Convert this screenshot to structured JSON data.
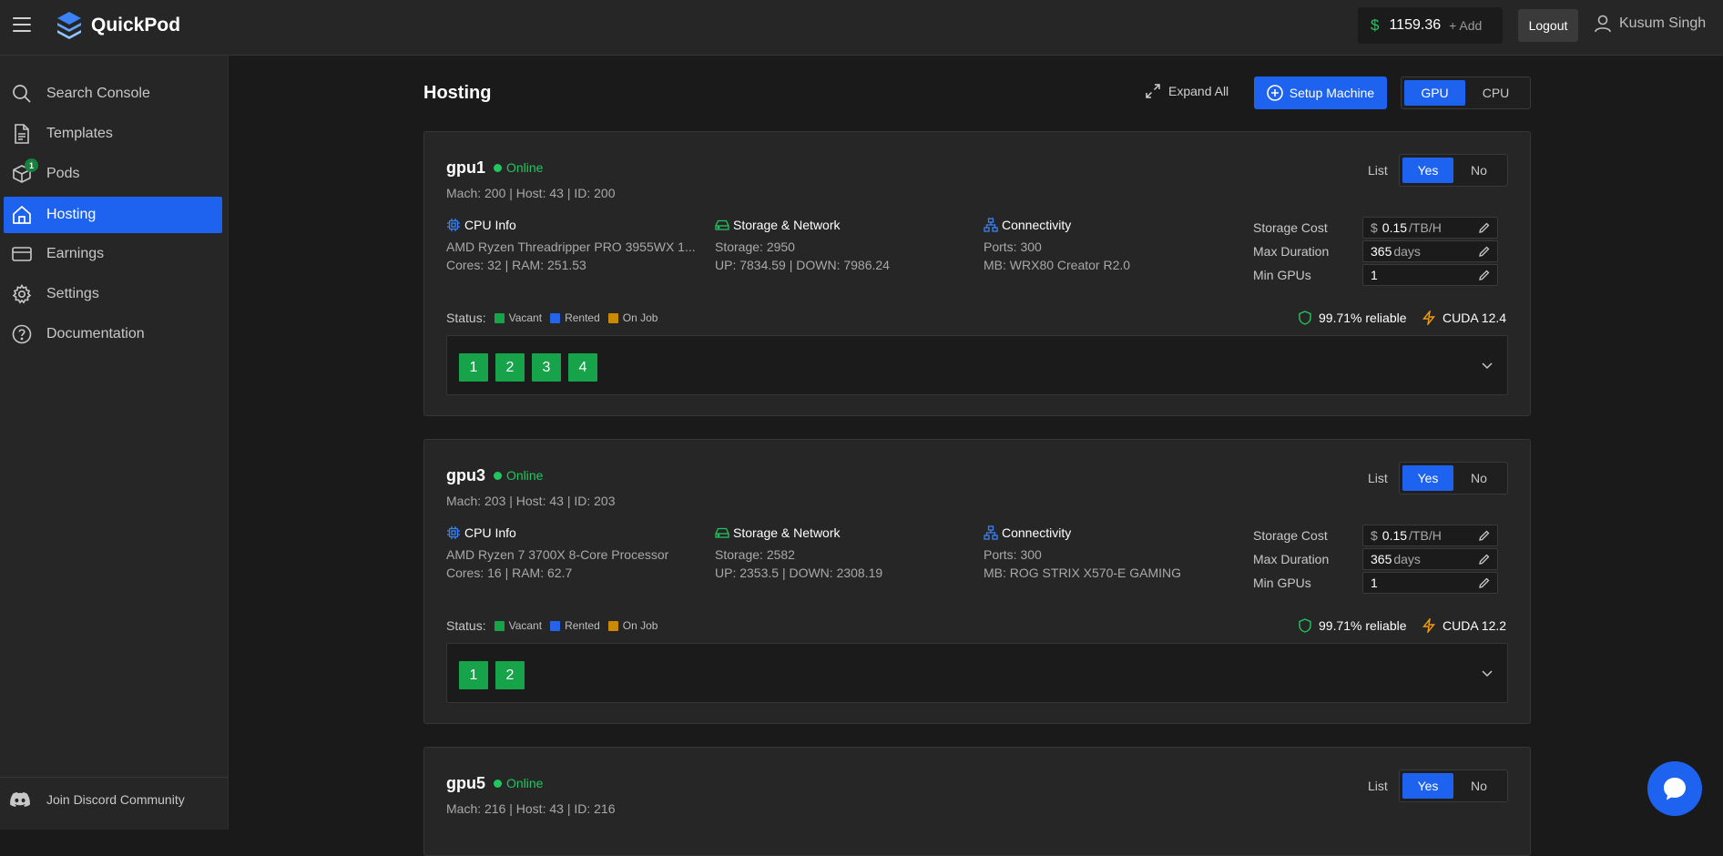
{
  "app": {
    "brand": "QuickPod"
  },
  "header": {
    "balance_symbol": "$",
    "balance": "1159.36",
    "add_label": "+ Add",
    "logout_label": "Logout",
    "user_name": "Kusum Singh"
  },
  "sidebar": {
    "items": [
      {
        "label": "Search Console",
        "icon": "search-icon"
      },
      {
        "label": "Templates",
        "icon": "document-icon"
      },
      {
        "label": "Pods",
        "icon": "cube-icon",
        "badge": "1"
      },
      {
        "label": "Hosting",
        "icon": "home-icon",
        "active": true
      },
      {
        "label": "Earnings",
        "icon": "credit-card-icon"
      },
      {
        "label": "Settings",
        "icon": "gear-icon"
      },
      {
        "label": "Documentation",
        "icon": "help-circle-icon"
      }
    ],
    "discord_label": "Join Discord Community"
  },
  "main": {
    "title": "Hosting",
    "expand_all_label": "Expand All",
    "setup_label": "Setup Machine",
    "toggle": {
      "gpu": "GPU",
      "cpu": "CPU",
      "selected": "GPU"
    }
  },
  "labels": {
    "online": "Online",
    "list": "List",
    "yes": "Yes",
    "no": "No",
    "cpu_info": "CPU Info",
    "storage_network": "Storage & Network",
    "connectivity": "Connectivity",
    "storage_cost": "Storage Cost",
    "max_duration": "Max Duration",
    "min_gpus": "Min GPUs",
    "status": "Status:",
    "vacant": "Vacant",
    "rented": "Rented",
    "on_job": "On Job",
    "cost_prefix": "$",
    "cost_unit": "/TB/H",
    "duration_unit": "days"
  },
  "colors": {
    "accent": "#1e63f0",
    "online": "#22c55e",
    "vacant": "#16a34a",
    "rented": "#2563eb",
    "on_job": "#ca8a04"
  },
  "hosts": [
    {
      "name": "gpu1",
      "status": "Online",
      "mach_line": "Mach: 200 | Host: 43 | ID: 200",
      "list_selected": "Yes",
      "cpu_name": "AMD Ryzen Threadripper PRO 3955WX 1...",
      "cpu_detail": "Cores: 32 | RAM: 251.53",
      "storage": "Storage: 2950",
      "network": "UP: 7834.59 | DOWN: 7986.24",
      "ports": "Ports: 300",
      "mb": "MB: WRX80 Creator R2.0",
      "storage_cost": "0.15",
      "max_duration": "365",
      "min_gpus": "1",
      "reliability": "99.71% reliable",
      "cuda": "CUDA 12.4",
      "gpus": [
        "1",
        "2",
        "3",
        "4"
      ]
    },
    {
      "name": "gpu3",
      "status": "Online",
      "mach_line": "Mach: 203 | Host: 43 | ID: 203",
      "list_selected": "Yes",
      "cpu_name": "AMD Ryzen 7 3700X 8-Core Processor",
      "cpu_detail": "Cores: 16 | RAM: 62.7",
      "storage": "Storage: 2582",
      "network": "UP: 2353.5 | DOWN: 2308.19",
      "ports": "Ports: 300",
      "mb": "MB: ROG STRIX X570-E GAMING",
      "storage_cost": "0.15",
      "max_duration": "365",
      "min_gpus": "1",
      "reliability": "99.71% reliable",
      "cuda": "CUDA 12.2",
      "gpus": [
        "1",
        "2"
      ]
    },
    {
      "name": "gpu5",
      "status": "Online",
      "mach_line": "Mach: 216 | Host: 43 | ID: 216",
      "list_selected": "Yes"
    }
  ]
}
